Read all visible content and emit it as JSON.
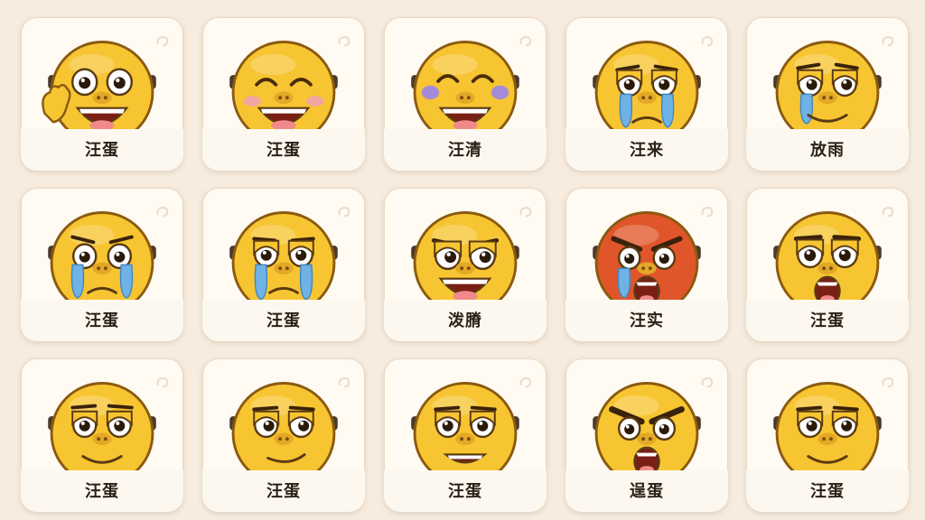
{
  "colors": {
    "background": "#f6ecdf",
    "tile": "#fffaf2",
    "face": "#f7c531",
    "face_red": "#e0562a",
    "tear": "#6fb3e6"
  },
  "stickers": [
    {
      "label": "汪蛋",
      "icon": "waving-face-icon",
      "face": "yellow"
    },
    {
      "label": "汪蛋",
      "icon": "laughing-face-icon",
      "face": "yellow"
    },
    {
      "label": "汪清",
      "icon": "tears-of-joy-face-icon",
      "face": "yellow"
    },
    {
      "label": "汪来",
      "icon": "crying-face-icon",
      "face": "yellow"
    },
    {
      "label": "放雨",
      "icon": "crying-smirk-face-icon",
      "face": "yellow"
    },
    {
      "label": "汪蛋",
      "icon": "sad-crying-face-icon",
      "face": "yellow"
    },
    {
      "label": "汪蛋",
      "icon": "sobbing-face-icon",
      "face": "yellow"
    },
    {
      "label": "泼膌",
      "icon": "grinning-smug-face-icon",
      "face": "yellow"
    },
    {
      "label": "汪实",
      "icon": "angry-crying-face-icon",
      "face": "red"
    },
    {
      "label": "汪蛋",
      "icon": "shocked-face-icon",
      "face": "yellow"
    },
    {
      "label": "汪蛋",
      "icon": "content-smile-face-icon",
      "face": "yellow"
    },
    {
      "label": "汪蛋",
      "icon": "smirk-face-icon",
      "face": "yellow"
    },
    {
      "label": "汪蛋",
      "icon": "grin-face-icon",
      "face": "yellow"
    },
    {
      "label": "逞蛋",
      "icon": "furious-face-icon",
      "face": "yellow"
    },
    {
      "label": "汪蛋",
      "icon": "smug-face-icon",
      "face": "yellow"
    }
  ]
}
